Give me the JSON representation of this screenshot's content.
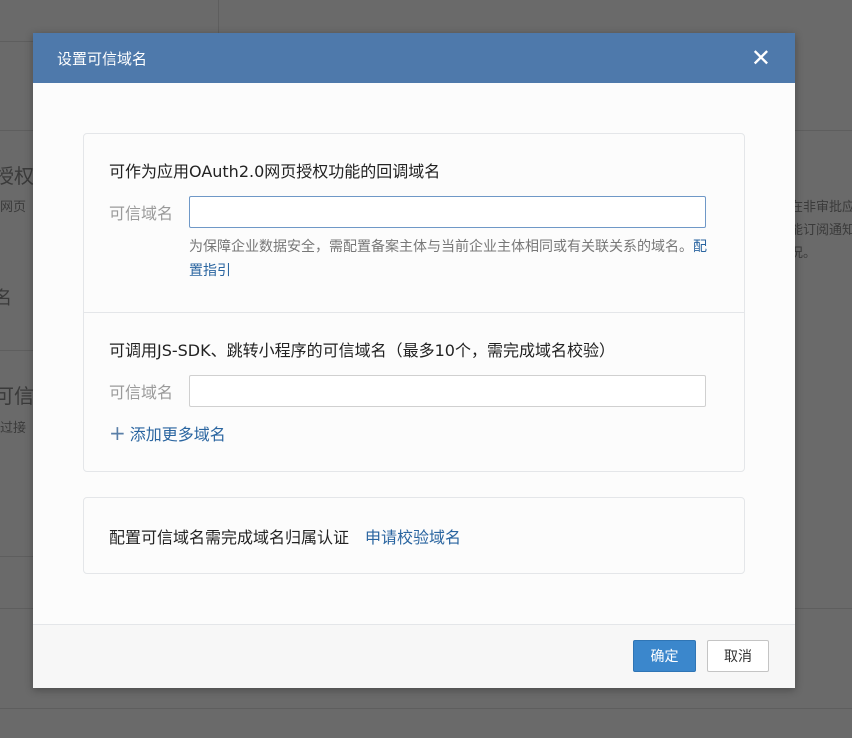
{
  "background": {
    "fragments": [
      "授权",
      "网页",
      "名",
      "可信",
      "过接",
      "在非审批应",
      "能订阅通知",
      "况。"
    ]
  },
  "dialog": {
    "title": "设置可信域名",
    "close_icon": "close-icon",
    "oauth": {
      "title": "可作为应用OAuth2.0网页授权功能的回调域名",
      "label": "可信域名",
      "value": "",
      "hint": "为保障企业数据安全，需配置备案主体与当前企业主体相同或有关联关系的域名。",
      "guide_link": "配置指引"
    },
    "jssdk": {
      "title": "可调用JS-SDK、跳转小程序的可信域名（最多10个，需完成域名校验）",
      "label": "可信域名",
      "value": "",
      "add_more": "添加更多域名",
      "add_icon": "plus-icon"
    },
    "verify": {
      "text": "配置可信域名需完成域名归属认证",
      "link": "申请校验域名"
    },
    "footer": {
      "confirm": "确定",
      "cancel": "取消"
    },
    "colors": {
      "header": "#4e79ab",
      "link": "#2a65a0",
      "primary": "#3b87cc"
    }
  }
}
